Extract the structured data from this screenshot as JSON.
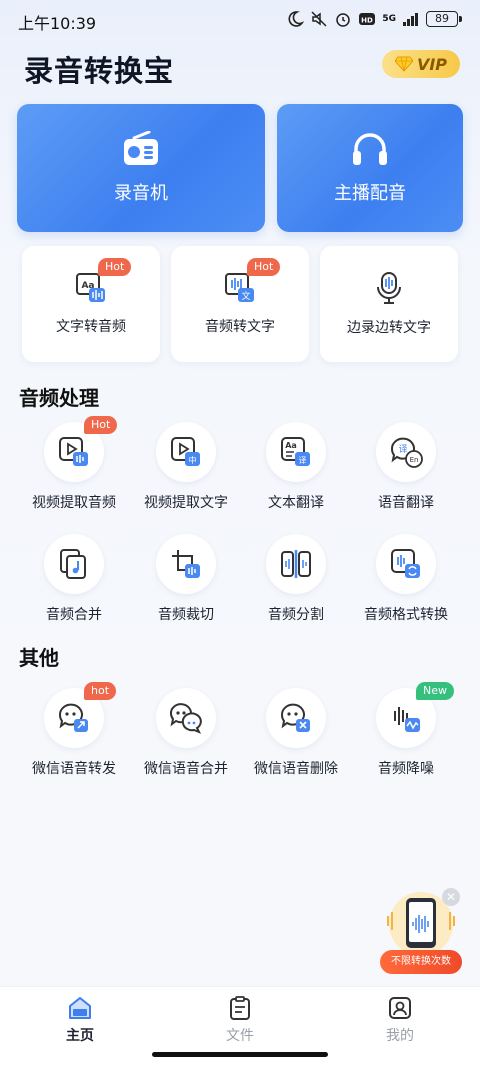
{
  "status_bar": {
    "time": "上午10:39",
    "network": "5G",
    "battery": "89"
  },
  "header": {
    "title": "录音转换宝",
    "vip_label": "VIP"
  },
  "main_cards": [
    {
      "label": "录音机",
      "icon": "radio-icon"
    },
    {
      "label": "主播配音",
      "icon": "headphones-icon"
    }
  ],
  "quick_tools": [
    {
      "label": "文字转音频",
      "tag": "Hot",
      "icon": "text-to-audio-icon"
    },
    {
      "label": "音频转文字",
      "tag": "Hot",
      "icon": "audio-to-text-icon"
    },
    {
      "label": "边录边转文字",
      "tag": "",
      "icon": "microphone-icon"
    }
  ],
  "audio_section": {
    "title": "音频处理",
    "items": [
      {
        "label": "视频提取音频",
        "tag": "Hot"
      },
      {
        "label": "视频提取文字",
        "tag": ""
      },
      {
        "label": "文本翻译",
        "tag": ""
      },
      {
        "label": "语音翻译",
        "tag": ""
      },
      {
        "label": "音频合并",
        "tag": ""
      },
      {
        "label": "音频裁切",
        "tag": ""
      },
      {
        "label": "音频分割",
        "tag": ""
      },
      {
        "label": "音频格式转换",
        "tag": ""
      }
    ]
  },
  "other_section": {
    "title": "其他",
    "items": [
      {
        "label": "微信语音转发",
        "tag": "hot"
      },
      {
        "label": "微信语音合并",
        "tag": ""
      },
      {
        "label": "微信语音删除",
        "tag": ""
      },
      {
        "label": "音频降噪",
        "tag": "New"
      }
    ]
  },
  "promo": {
    "label": "不限转换次数"
  },
  "bottom_nav": [
    {
      "label": "主页",
      "active": true
    },
    {
      "label": "文件",
      "active": false
    },
    {
      "label": "我的",
      "active": false
    }
  ],
  "colors": {
    "primary": "#3d7ff0",
    "hot_tag": "#f0684c",
    "new_tag": "#35c17d",
    "vip_gold": "#f7c948"
  }
}
